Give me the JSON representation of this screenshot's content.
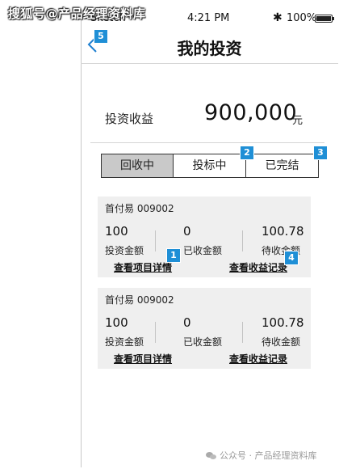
{
  "watermark": {
    "top_text": "搜狐号@产品经理资料库",
    "bottom_text": "公众号 · 产品经理资料库"
  },
  "status_bar": {
    "carrier": "Sketch",
    "time": "4:21 PM",
    "bluetooth_icon": "bluetooth-icon",
    "battery_text": "100%",
    "battery_icon": "battery-icon"
  },
  "nav": {
    "title": "我的投资",
    "back_icon": "chevron-left-icon"
  },
  "earnings": {
    "label": "投资收益",
    "value": "900,000",
    "unit": "元"
  },
  "tabs": [
    {
      "label": "回收中",
      "active": true
    },
    {
      "label": "投标中",
      "active": false
    },
    {
      "label": "已完结",
      "active": false
    }
  ],
  "cards": [
    {
      "title": "首付易 009002",
      "stats": [
        {
          "value": "100",
          "label": "投资金额"
        },
        {
          "value": "0",
          "label": "已收金额"
        },
        {
          "value": "100.78",
          "label": "待收金额"
        }
      ],
      "link_detail": "查看项目详情",
      "link_records": "查看收益记录"
    },
    {
      "title": "首付易 009002",
      "stats": [
        {
          "value": "100",
          "label": "投资金额"
        },
        {
          "value": "0",
          "label": "已收金额"
        },
        {
          "value": "100.78",
          "label": "待收金额"
        }
      ],
      "link_detail": "查看项目详情",
      "link_records": "查看收益记录"
    }
  ],
  "annotation_badges": [
    "1",
    "2",
    "3",
    "4",
    "5"
  ],
  "colors": {
    "badge": "#1f8fd6",
    "active_tab": "#c9c9c9",
    "card_bg": "#efefef"
  }
}
